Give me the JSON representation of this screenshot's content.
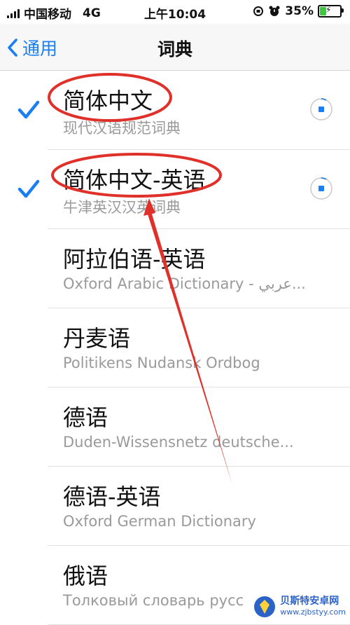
{
  "status_bar": {
    "carrier": "中国移动",
    "network": "4G",
    "time": "上午10:04",
    "battery_percent": "35%",
    "battery_level": 0.35,
    "icons": [
      "signal-icon",
      "orientation-lock-icon",
      "alarm-icon",
      "battery-charging-icon"
    ]
  },
  "nav": {
    "back_label": "通用",
    "title": "词典"
  },
  "dictionaries": [
    {
      "title": "简体中文",
      "subtitle": "现代汉语规范词典",
      "checked": true,
      "downloading": true
    },
    {
      "title": "简体中文-英语",
      "subtitle": "牛津英汉汉英词典",
      "checked": true,
      "downloading": true
    },
    {
      "title": "阿拉伯语-英语",
      "subtitle": "Oxford Arabic Dictionary - عربي...",
      "checked": false,
      "downloading": false
    },
    {
      "title": "丹麦语",
      "subtitle": "Politikens Nudansk Ordbog",
      "checked": false,
      "downloading": false
    },
    {
      "title": "德语",
      "subtitle": "Duden-Wissensnetz deutsche...",
      "checked": false,
      "downloading": false
    },
    {
      "title": "德语-英语",
      "subtitle": "Oxford German Dictionary",
      "checked": false,
      "downloading": false
    },
    {
      "title": "俄语",
      "subtitle": "Толковый словарь русс",
      "checked": false,
      "downloading": false
    }
  ],
  "watermark": {
    "name": "贝斯特安卓网",
    "url": "www.zjbstyy.com"
  },
  "colors": {
    "accent": "#1a7ff2",
    "annotation": "#e0302a",
    "subtitle": "#9a9a9a"
  }
}
